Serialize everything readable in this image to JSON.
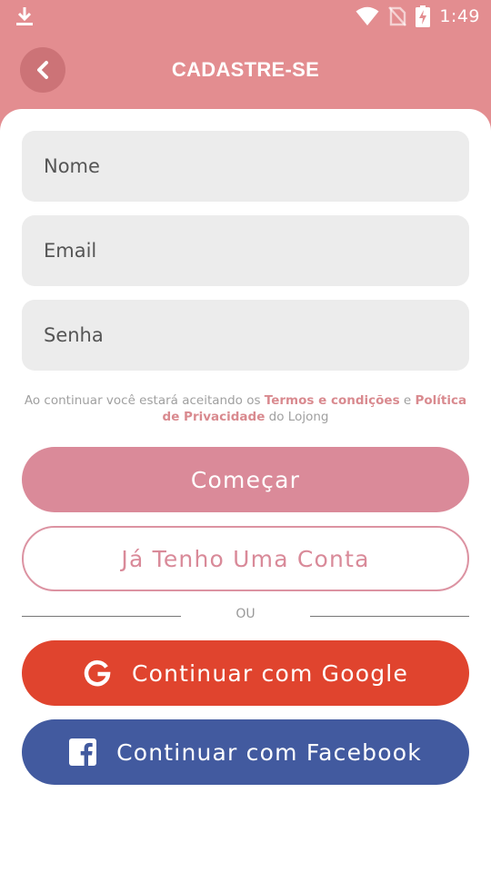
{
  "status_bar": {
    "time": "1:49"
  },
  "header": {
    "title": "CADASTRE-SE"
  },
  "form": {
    "name_placeholder": "Nome",
    "email_placeholder": "Email",
    "password_placeholder": "Senha"
  },
  "terms": {
    "prefix": "Ao continuar você estará aceitando os ",
    "terms_link": "Termos e condições",
    "connector": " e ",
    "privacy_link": "Política de Privacidade",
    "suffix": " do Lojong"
  },
  "buttons": {
    "start": "Começar",
    "have_account": "Já Tenho Uma Conta",
    "google": "Continuar com Google",
    "facebook": "Continuar com Facebook"
  },
  "divider": {
    "label": "OU"
  },
  "colors": {
    "header_bg": "#e38d90",
    "start_button": "#da8a99",
    "link": "#d98a8f",
    "google": "#e0442e",
    "facebook": "#425a9f"
  }
}
